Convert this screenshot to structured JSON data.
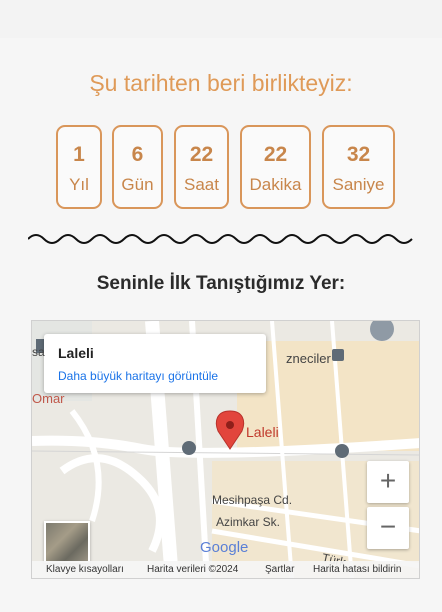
{
  "header": {
    "since_title": "Şu tarihten beri birlikteyiz:"
  },
  "counters": [
    {
      "value": "1",
      "unit": "Yıl"
    },
    {
      "value": "6",
      "unit": "Gün"
    },
    {
      "value": "22",
      "unit": "Saat"
    },
    {
      "value": "22",
      "unit": "Dakika"
    },
    {
      "value": "32",
      "unit": "Saniye"
    }
  ],
  "place": {
    "title": "Seninle İlk Tanıştığımız Yer:"
  },
  "map": {
    "info_title": "Laleli",
    "info_link": "Daha büyük haritayı görüntüle",
    "pin_label": "Laleli",
    "labels": {
      "omar": "Omar",
      "sa": "sa",
      "eziciler": "zneciler",
      "mesihpasa": "Mesihpaşa Cd.",
      "azimkar": "Azimkar Sk.",
      "turk": "Türk"
    },
    "google_logo": "Google",
    "zoom_in": "+",
    "zoom_out": "−",
    "footer": {
      "shortcuts": "Klavye kısayolları",
      "data": "Harita verileri ©2024",
      "terms": "Şartlar",
      "report": "Harita hatası bildirin"
    },
    "colors": {
      "pin": "#e2453c",
      "link": "#1a73e8",
      "accent": "#df9a58"
    }
  }
}
